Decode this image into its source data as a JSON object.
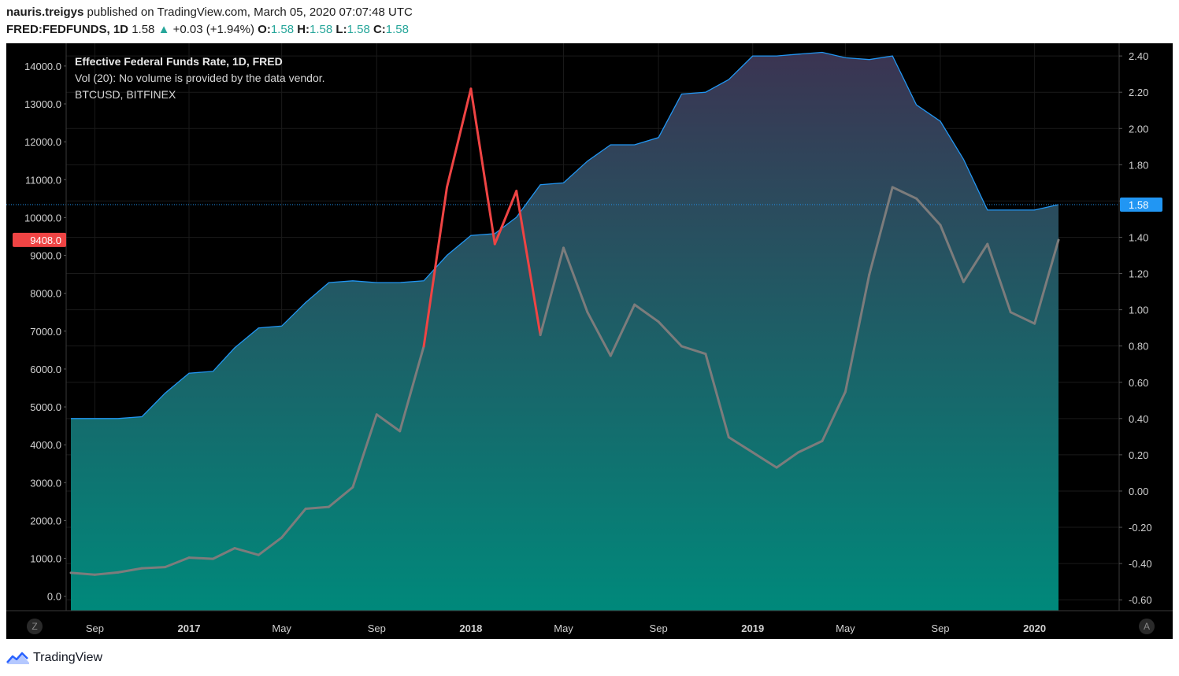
{
  "header": {
    "author": "nauris.treigys",
    "published": "published on TradingView.com, March 05, 2020 07:07:48 UTC",
    "symbol": "FRED:FEDFUNDS, 1D",
    "last": "1.58",
    "up_arrow": "▲",
    "change": "+0.03 (+1.94%)",
    "o_label": "O:",
    "o_value": "1.58",
    "h_label": "H:",
    "h_value": "1.58",
    "l_label": "L:",
    "l_value": "1.58",
    "c_label": "C:",
    "c_value": "1.58"
  },
  "legend": {
    "line1": "Effective Federal Funds Rate, 1D, FRED",
    "line2": "Vol (20): No volume is provided by the data vendor.",
    "line3": "BTCUSD, BITFINEX"
  },
  "footer": {
    "brand": "TradingView",
    "logo_icon": "tradingview-logo-icon"
  },
  "buttons": {
    "left": "Z",
    "right": "A"
  },
  "colors": {
    "background": "#000000",
    "fed_line": "#2196f3",
    "area_top": "#3b3452",
    "area_bottom": "#00897b",
    "btc_gray": "#7c7c7c",
    "btc_red": "#ef4444",
    "price_label": "#2196f3",
    "btc_label": "#ef4444"
  },
  "chart_data": {
    "type": "area",
    "x_ticks": [
      {
        "label": "Sep",
        "date": "2016-09-01",
        "bold": false
      },
      {
        "label": "2017",
        "date": "2017-01-01",
        "bold": true
      },
      {
        "label": "May",
        "date": "2017-05-01",
        "bold": false
      },
      {
        "label": "Sep",
        "date": "2017-09-01",
        "bold": false
      },
      {
        "label": "2018",
        "date": "2018-01-01",
        "bold": true
      },
      {
        "label": "May",
        "date": "2018-05-01",
        "bold": false
      },
      {
        "label": "Sep",
        "date": "2018-09-01",
        "bold": false
      },
      {
        "label": "2019",
        "date": "2019-01-01",
        "bold": true
      },
      {
        "label": "May",
        "date": "2019-05-01",
        "bold": false
      },
      {
        "label": "Sep",
        "date": "2019-09-01",
        "bold": false
      },
      {
        "label": "2020",
        "date": "2020-01-01",
        "bold": true
      }
    ],
    "left_axis": {
      "series": "BTCUSD, BITFINEX",
      "ylim": [
        -380,
        14600
      ],
      "ticks": [
        "0.0",
        "1000.0",
        "2000.0",
        "3000.0",
        "4000.0",
        "5000.0",
        "6000.0",
        "7000.0",
        "8000.0",
        "9000.0",
        "10000.0",
        "11000.0",
        "12000.0",
        "13000.0",
        "14000.0"
      ],
      "last_value_label": "9408.0"
    },
    "right_axis": {
      "series": "Effective Federal Funds Rate, 1D, FRED",
      "ylim": [
        -0.66,
        2.47
      ],
      "ticks": [
        "-0.60",
        "-0.40",
        "-0.20",
        "0.00",
        "0.20",
        "0.40",
        "0.60",
        "0.80",
        "1.00",
        "1.20",
        "1.40",
        "1.60",
        "1.80",
        "2.00",
        "2.20",
        "2.40"
      ],
      "last_value_label": "1.58",
      "current_value": 1.58
    },
    "series": [
      {
        "name": "Effective Federal Funds Rate, 1D, FRED",
        "kind": "area",
        "axis": "right",
        "points": [
          [
            "2016-08-01",
            0.4
          ],
          [
            "2016-09-01",
            0.4
          ],
          [
            "2016-10-01",
            0.4
          ],
          [
            "2016-11-01",
            0.41
          ],
          [
            "2016-12-01",
            0.54
          ],
          [
            "2017-01-01",
            0.65
          ],
          [
            "2017-02-01",
            0.66
          ],
          [
            "2017-03-01",
            0.79
          ],
          [
            "2017-04-01",
            0.9
          ],
          [
            "2017-05-01",
            0.91
          ],
          [
            "2017-06-01",
            1.04
          ],
          [
            "2017-07-01",
            1.15
          ],
          [
            "2017-08-01",
            1.16
          ],
          [
            "2017-09-01",
            1.15
          ],
          [
            "2017-10-01",
            1.15
          ],
          [
            "2017-11-01",
            1.16
          ],
          [
            "2017-12-01",
            1.3
          ],
          [
            "2018-01-01",
            1.41
          ],
          [
            "2018-02-01",
            1.42
          ],
          [
            "2018-03-01",
            1.51
          ],
          [
            "2018-04-01",
            1.69
          ],
          [
            "2018-05-01",
            1.7
          ],
          [
            "2018-06-01",
            1.82
          ],
          [
            "2018-07-01",
            1.91
          ],
          [
            "2018-08-01",
            1.91
          ],
          [
            "2018-09-01",
            1.95
          ],
          [
            "2018-10-01",
            2.19
          ],
          [
            "2018-11-01",
            2.2
          ],
          [
            "2018-12-01",
            2.27
          ],
          [
            "2019-01-01",
            2.4
          ],
          [
            "2019-02-01",
            2.4
          ],
          [
            "2019-03-01",
            2.41
          ],
          [
            "2019-04-01",
            2.42
          ],
          [
            "2019-05-01",
            2.39
          ],
          [
            "2019-06-01",
            2.38
          ],
          [
            "2019-07-01",
            2.4
          ],
          [
            "2019-08-01",
            2.13
          ],
          [
            "2019-09-01",
            2.04
          ],
          [
            "2019-10-01",
            1.83
          ],
          [
            "2019-11-01",
            1.55
          ],
          [
            "2019-12-01",
            1.55
          ],
          [
            "2020-01-01",
            1.55
          ],
          [
            "2020-02-01",
            1.58
          ]
        ]
      },
      {
        "name": "BTCUSD, BITFINEX",
        "kind": "line",
        "axis": "left",
        "points": [
          [
            "2016-08-01",
            620
          ],
          [
            "2016-09-01",
            570
          ],
          [
            "2016-10-01",
            630
          ],
          [
            "2016-11-01",
            740
          ],
          [
            "2016-12-01",
            770
          ],
          [
            "2017-01-01",
            1020
          ],
          [
            "2017-02-01",
            990
          ],
          [
            "2017-03-01",
            1270
          ],
          [
            "2017-04-01",
            1090
          ],
          [
            "2017-05-01",
            1550
          ],
          [
            "2017-06-01",
            2310
          ],
          [
            "2017-07-01",
            2360
          ],
          [
            "2017-08-01",
            2880
          ],
          [
            "2017-09-01",
            4800
          ],
          [
            "2017-10-01",
            4360
          ],
          [
            "2017-11-01",
            6600
          ],
          [
            "2017-12-01",
            10800
          ],
          [
            "2018-01-01",
            13400
          ],
          [
            "2018-02-01",
            9300
          ],
          [
            "2018-03-01",
            10700
          ],
          [
            "2018-04-01",
            6900
          ],
          [
            "2018-05-01",
            9200
          ],
          [
            "2018-06-01",
            7500
          ],
          [
            "2018-07-01",
            6350
          ],
          [
            "2018-08-01",
            7700
          ],
          [
            "2018-09-01",
            7250
          ],
          [
            "2018-10-01",
            6600
          ],
          [
            "2018-11-01",
            6400
          ],
          [
            "2018-12-01",
            4200
          ],
          [
            "2019-01-01",
            3800
          ],
          [
            "2019-02-01",
            3400
          ],
          [
            "2019-03-01",
            3800
          ],
          [
            "2019-04-01",
            4100
          ],
          [
            "2019-05-01",
            5400
          ],
          [
            "2019-06-01",
            8500
          ],
          [
            "2019-07-01",
            10800
          ],
          [
            "2019-08-01",
            10500
          ],
          [
            "2019-09-01",
            9800
          ],
          [
            "2019-10-01",
            8300
          ],
          [
            "2019-11-01",
            9300
          ],
          [
            "2019-12-01",
            7500
          ],
          [
            "2020-01-01",
            7200
          ],
          [
            "2020-02-01",
            9408
          ]
        ]
      }
    ]
  }
}
